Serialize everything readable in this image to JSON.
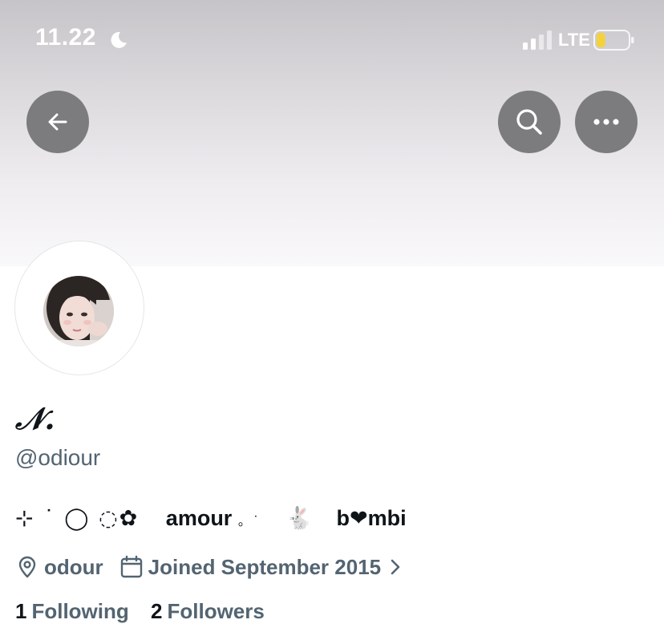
{
  "status_bar": {
    "time": "11.22",
    "network": "LTE"
  },
  "colors": {
    "header_button_bg": "#7c7b7e",
    "text_primary": "#0f1419",
    "text_secondary": "#536471",
    "battery_level_color": "#f5d23c"
  },
  "status_icons": {
    "moon": "moon-icon",
    "signal": "signal-icon",
    "battery": "battery-icon",
    "battery_level": 0.28
  },
  "header": {
    "back_icon": "arrow-left-icon",
    "search_icon": "search-icon",
    "more_icon": "more-horizontal-icon"
  },
  "profile": {
    "display_name": "𝒩.",
    "handle": "@odiour",
    "bio": {
      "decoration": "⊹ ˙ ◯ ◌✿",
      "word1": "amour",
      "dot": "。˙",
      "emoji": "🐇",
      "word2": "b❤mbi"
    },
    "location": "odour",
    "joined": "Joined September 2015",
    "following_count": "1",
    "following_label": "Following",
    "followers_count": "2",
    "followers_label": "Followers"
  }
}
